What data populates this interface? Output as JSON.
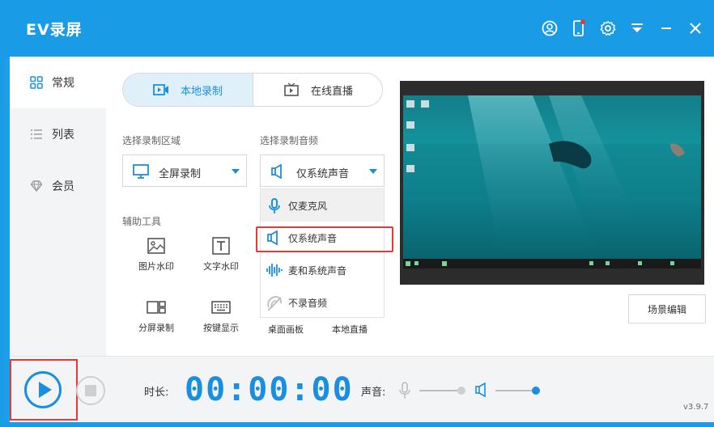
{
  "window": {
    "title": "EV录屏"
  },
  "sidebar": {
    "items": [
      {
        "label": "常规",
        "icon": "grid-icon",
        "active": true
      },
      {
        "label": "列表",
        "icon": "list-icon",
        "active": false
      },
      {
        "label": "会员",
        "icon": "diamond-icon",
        "active": false
      }
    ]
  },
  "tabs": [
    {
      "label": "本地录制",
      "icon": "record-icon",
      "active": true
    },
    {
      "label": "在线直播",
      "icon": "tv-icon",
      "active": false
    }
  ],
  "region": {
    "label": "选择录制区域",
    "selected": "全屏录制"
  },
  "audio": {
    "label": "选择录制音频",
    "selected": "仅系统声音",
    "options": [
      {
        "label": "仅麦克风",
        "icon": "microphone-icon"
      },
      {
        "label": "仅系统声音",
        "icon": "speaker-icon"
      },
      {
        "label": "麦和系统声音",
        "icon": "waveform-icon"
      },
      {
        "label": "不录音频",
        "icon": "mute-icon"
      }
    ]
  },
  "tools": {
    "label": "辅助工具",
    "items": [
      {
        "label": "图片水印",
        "icon": "image-icon"
      },
      {
        "label": "文字水印",
        "icon": "text-icon"
      },
      {
        "label": "分屏录制",
        "icon": "split-screen-icon"
      },
      {
        "label": "按键显示",
        "icon": "keyboard-icon"
      },
      {
        "label": "桌面画板",
        "icon": ""
      },
      {
        "label": "本地直播",
        "icon": ""
      }
    ]
  },
  "scene_button": "场景编辑",
  "bottom": {
    "duration_label": "时长:",
    "timer": "00:00:00",
    "volume_label": "声音:",
    "mic_level": 1.0,
    "system_level": 1.0
  },
  "version": "v3.9.7",
  "colors": {
    "brand": "#1a9be6",
    "accent": "#1a8fe0",
    "highlight": "#e53935"
  }
}
